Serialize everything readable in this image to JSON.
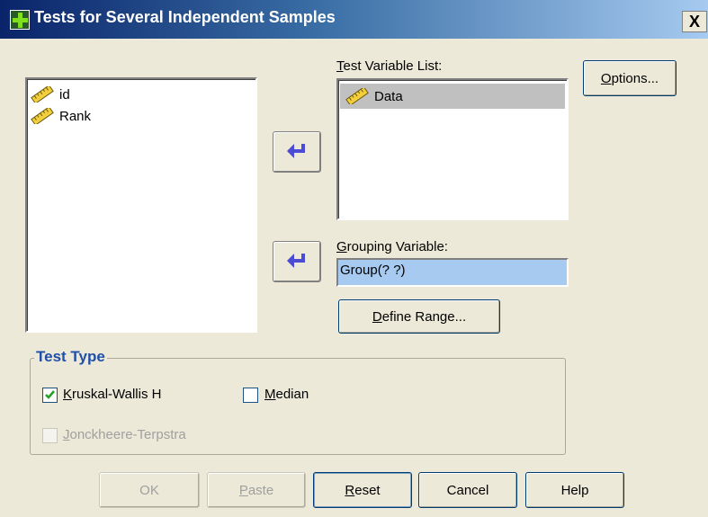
{
  "window": {
    "title": "Tests for Several Independent Samples",
    "close_glyph": "X"
  },
  "source_list": {
    "items": [
      {
        "label": "id",
        "icon": "scale-ruler-icon"
      },
      {
        "label": "Rank",
        "icon": "scale-ruler-icon"
      }
    ]
  },
  "test_variable_list": {
    "label_mnemonic": "T",
    "label_rest": "est Variable List:",
    "items": [
      {
        "label": "Data",
        "icon": "scale-ruler-icon",
        "selected": true
      }
    ]
  },
  "grouping_variable": {
    "label_mnemonic": "G",
    "label_rest": "rouping Variable:",
    "value": "Group(? ?)"
  },
  "buttons": {
    "options_mnemonic": "O",
    "options_rest": "ptions...",
    "define_range_mnemonic": "D",
    "define_range_rest": "efine Range...",
    "ok": "OK",
    "paste_mnemonic": "P",
    "paste_rest": "aste",
    "reset_mnemonic": "R",
    "reset_rest": "eset",
    "cancel": "Cancel",
    "help": "Help"
  },
  "test_type": {
    "title": "Test Type",
    "kruskal_mnemonic": "K",
    "kruskal_rest": "ruskal-Wallis H",
    "kruskal_checked": true,
    "median_mnemonic": "M",
    "median_rest": "edian",
    "median_checked": false,
    "jonckheere_mnemonic": "J",
    "jonckheere_rest": "onckheere-Terpstra",
    "jonckheere_checked": false,
    "jonckheere_enabled": false
  },
  "colors": {
    "dialog_bg": "#ece9d8",
    "title_bar": "#0a246a",
    "selection": "#c0c0c0",
    "grouping_highlight": "#a6caf0",
    "group_title": "#1f4fa8",
    "arrow": "#4b4bd6"
  }
}
